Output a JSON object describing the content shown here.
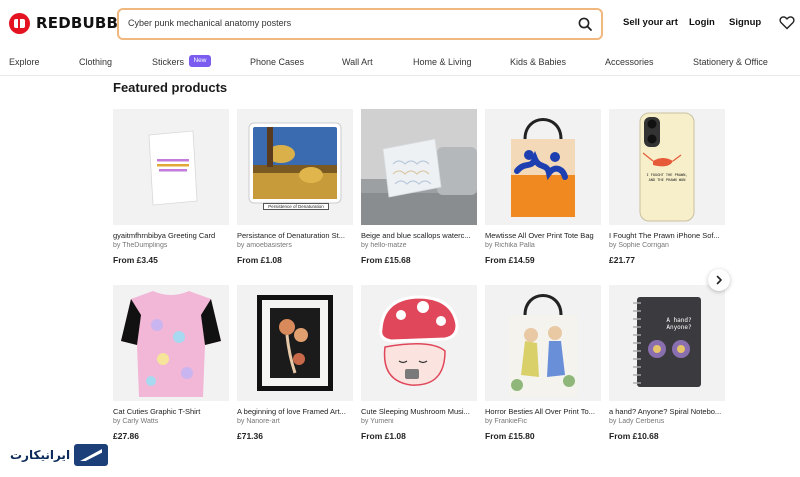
{
  "header": {
    "logo_text": "REDBUBBLE",
    "search_value": "Cyber punk mechanical anatomy posters",
    "sell_label": "Sell your art",
    "login_label": "Login",
    "signup_label": "Signup"
  },
  "nav": {
    "items": [
      "Explore",
      "Clothing",
      "Stickers",
      "Phone Cases",
      "Wall Art",
      "Home & Living",
      "Kids & Babies",
      "Accessories",
      "Stationery & Office"
    ],
    "new_badge": "New"
  },
  "section_title": "Featured products",
  "products": [
    {
      "title": "gyaitmfhrnbibya Greeting Card",
      "artist": "by TheDumplings",
      "price": "From £3.45"
    },
    {
      "title": "Persistance of Denaturation St...",
      "artist": "by amoebasisters",
      "price": "From £1.08",
      "caption": "Persistence of Denaturation"
    },
    {
      "title": "Beige and blue scallops waterc...",
      "artist": "by hello-matze",
      "price": "From £15.68"
    },
    {
      "title": "Mewtisse All Over Print Tote Bag",
      "artist": "by Richika Palla",
      "price": "From £14.59"
    },
    {
      "title": "I Fought The Prawn iPhone Sof...",
      "artist": "by Sophie Corrigan",
      "price": "£21.77",
      "case_text": "I FOUGHT THE PRAWN, AND THE PRAWN WON"
    },
    {
      "title": "Cat Cuties Graphic T-Shirt",
      "artist": "by Carly Watts",
      "price": "£27.86"
    },
    {
      "title": "A beginning of love Framed Art...",
      "artist": "by Nanore-art",
      "price": "£71.36"
    },
    {
      "title": "Cute Sleeping Mushroom Musi...",
      "artist": "by Yumeni",
      "price": "From £1.08"
    },
    {
      "title": "Horror Besties All Over Print To...",
      "artist": "by FrankieFic",
      "price": "From £15.80"
    },
    {
      "title": "a hand? Anyone? Spiral Notebo...",
      "artist": "by Lady Cerberus",
      "price": "From £10.68",
      "notebook_text": "A hand? Anyone?"
    }
  ],
  "watermark": "ایرانیکارت"
}
